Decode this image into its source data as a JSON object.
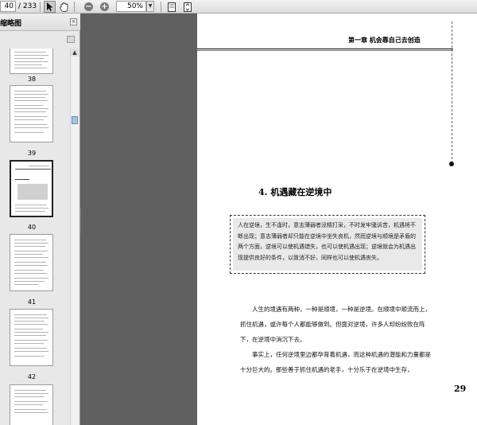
{
  "toolbar": {
    "current_page": "40",
    "total_pages": "/ 233",
    "zoom": "50%",
    "zoom_out_label": "−",
    "zoom_in_label": "+",
    "dropdown_arrow": "▼"
  },
  "panel": {
    "title": "缩略图",
    "close_label": "×",
    "thumbnails": [
      {
        "label": "38"
      },
      {
        "label": "39"
      },
      {
        "label": "40"
      },
      {
        "label": "41"
      },
      {
        "label": "42"
      }
    ]
  },
  "page": {
    "header": "第一章   机会靠自己去创造",
    "section_title": "4. 机遇藏在逆境中",
    "quote": "人在逆境，生不逢时，意志薄弱者没精打采，不时发牢骚诉苦，机遇将不断出现；意志薄弱者却只能在逆境中坐失良机，然而逆境与顺境是矛盾的两个方面，逆境可以使机遇错失，也可以使机遇出现；逆境就会为机遇出现提供良好的条件，以致消不好，同样也可以使机遇丧失。",
    "body": [
      "人生的境遇有两种，一种是顺境，一种是逆境。在顺境中顺流而上，抓住机遇，或许每个人都能够做到。但面对逆境，许多人却纷纷败在阵下，在逆境中消沉下去。",
      "事实上，任何逆境里边都孕育着机遇，而这种机遇的潜能和力量都是十分巨大的。那些善于抓住机遇的老手，十分乐于在逆境中生存，"
    ],
    "page_number": "29"
  }
}
